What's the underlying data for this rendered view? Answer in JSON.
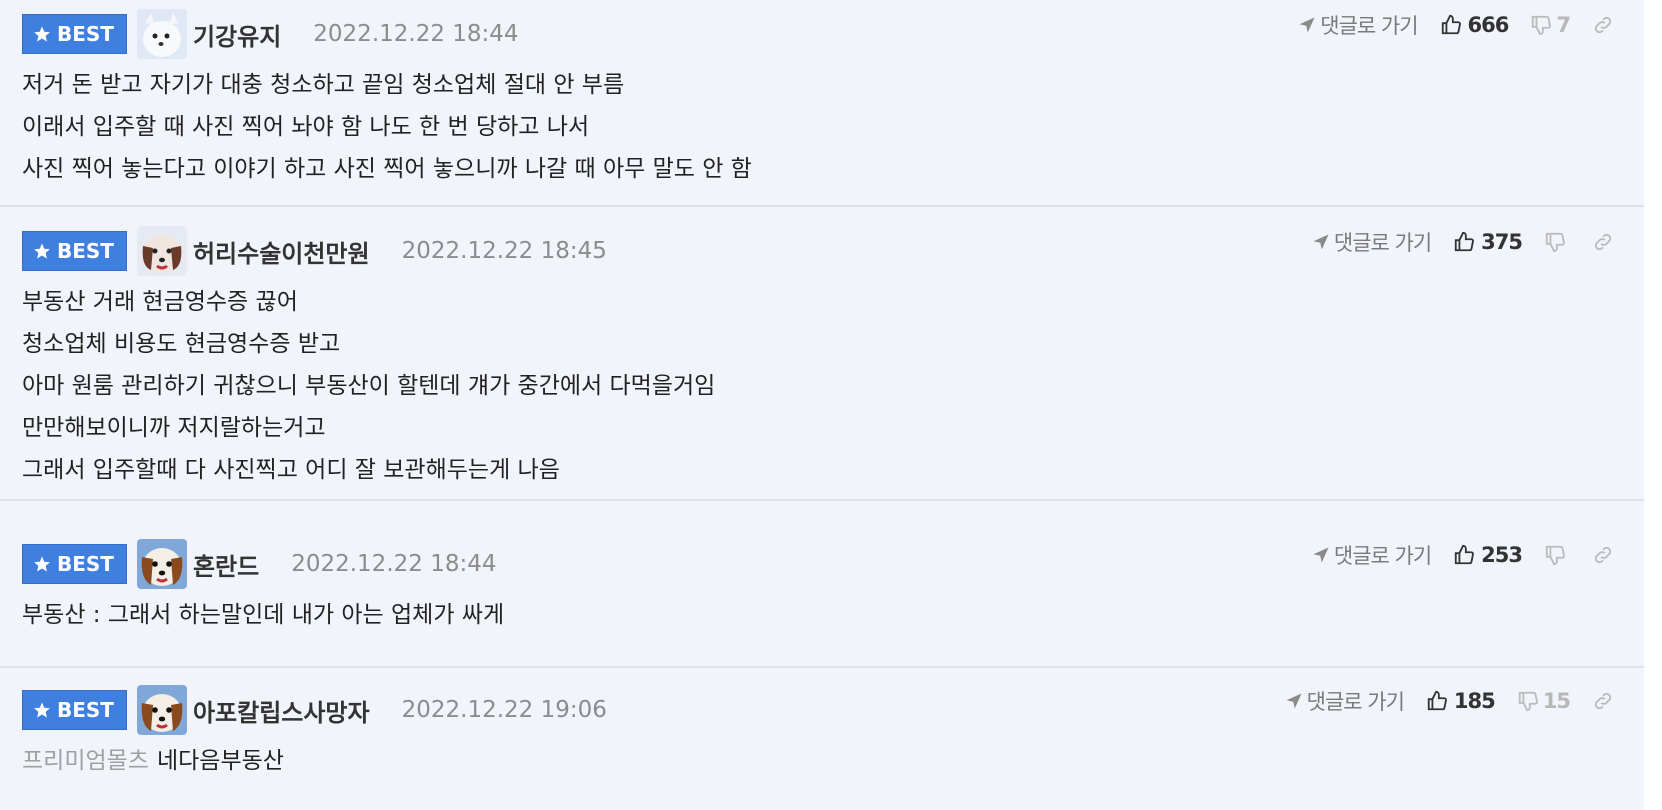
{
  "comments": [
    {
      "badge": "BEST",
      "nickname": "기강유지",
      "date": "2022.12.22 18:44",
      "goto_label": "댓글로 가기",
      "likes": "666",
      "dislikes": "7",
      "lines": [
        "저거 돈 받고 자기가 대충 청소하고 끝임 청소업체 절대 안 부름",
        "이래서 입주할 때 사진 찍어 놔야 함 나도 한 번 당하고 나서",
        "사진 찍어 놓는다고 이야기 하고 사진 찍어 놓으니까 나갈 때 아무 말도 안 함"
      ]
    },
    {
      "badge": "BEST",
      "nickname": "허리수술이천만원",
      "date": "2022.12.22 18:45",
      "goto_label": "댓글로 가기",
      "likes": "375",
      "dislikes": "",
      "lines": [
        "부동산 거래 현금영수증 끊어",
        "청소업체 비용도 현금영수증 받고",
        "아마 원룸 관리하기 귀찮으니 부동산이 할텐데 걔가 중간에서 다먹을거임",
        "만만해보이니까 저지랄하는거고",
        "그래서 입주할때 다 사진찍고 어디 잘 보관해두는게 나음"
      ]
    },
    {
      "badge": "BEST",
      "nickname": "혼란드",
      "date": "2022.12.22 18:44",
      "goto_label": "댓글로 가기",
      "likes": "253",
      "dislikes": "",
      "lines": [
        "부동산 : 그래서 하는말인데 내가 아는 업체가 싸게"
      ]
    },
    {
      "badge": "BEST",
      "nickname": "아포칼립스사망자",
      "date": "2022.12.22 19:06",
      "goto_label": "댓글로 가기",
      "likes": "185",
      "dislikes": "15",
      "reply_to": "프리미엄몰츠",
      "lines": [
        "네다음부동산"
      ]
    }
  ],
  "colors": {
    "background": "#f2f4fb",
    "badge": "#3f7fe0",
    "divider": "#dde1ea",
    "date": "#8c8c8c",
    "muted": "#a0a0a0"
  },
  "icons": {
    "badge": "star-icon",
    "goto": "arrow-icon",
    "like": "thumbs-up-icon",
    "dislike": "thumbs-down-icon",
    "link": "link-icon"
  }
}
